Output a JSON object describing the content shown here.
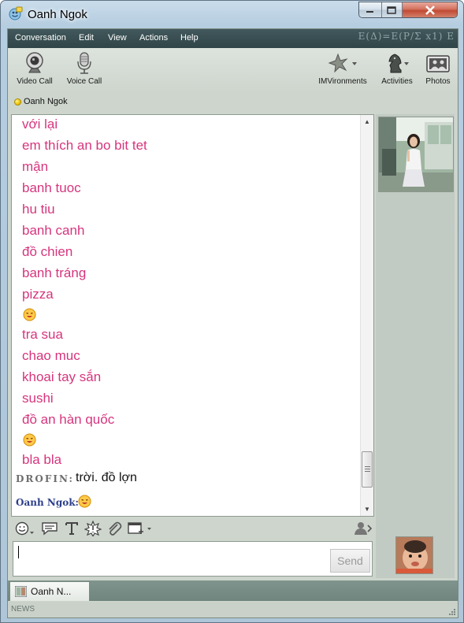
{
  "window": {
    "title": "Oanh Ngok"
  },
  "menu": {
    "items": [
      "Conversation",
      "Edit",
      "View",
      "Actions",
      "Help"
    ],
    "decoration": "E(Δ)=E(P/Σ x1) E"
  },
  "toolbar": {
    "video_call": "Video Call",
    "voice_call": "Voice Call",
    "imvironments": "IMVironments",
    "activities": "Activities",
    "photos": "Photos"
  },
  "contact": {
    "name": "Oanh Ngok",
    "status_color": "#f0c000"
  },
  "conversation": {
    "lines": [
      {
        "type": "text",
        "text": "với lại"
      },
      {
        "type": "text",
        "text": "em thích an bo bit tet"
      },
      {
        "type": "text",
        "text": "mận"
      },
      {
        "type": "text",
        "text": "banh tuoc"
      },
      {
        "type": "text",
        "text": "hu tiu"
      },
      {
        "type": "text",
        "text": "banh canh"
      },
      {
        "type": "text",
        "text": "đồ chien"
      },
      {
        "type": "text",
        "text": "banh tráng"
      },
      {
        "type": "text",
        "text": "pizza"
      },
      {
        "type": "emoticon",
        "icon": "smiley-emoticon"
      },
      {
        "type": "text",
        "text": "tra sua"
      },
      {
        "type": "text",
        "text": "chao muc"
      },
      {
        "type": "text",
        "text": "khoai tay sắn"
      },
      {
        "type": "text",
        "text": "sushi"
      },
      {
        "type": "text",
        "text": "đồ an hàn quốc"
      },
      {
        "type": "emoticon",
        "icon": "smiley-emoticon"
      },
      {
        "type": "text",
        "text": "bla bla"
      }
    ],
    "drofin": {
      "sender": "DROFIN:",
      "text": "trời. đồ lợn"
    },
    "oanh": {
      "sender": "Oanh Ngok:",
      "icon": "smiley-emoticon"
    },
    "message_color": "#d6357d"
  },
  "format_toolbar": [
    "emoticon-icon",
    "audible-icon",
    "text-format-icon",
    "buzz-icon",
    "attach-icon",
    "window-icon",
    "contact-icon"
  ],
  "input": {
    "value": "",
    "send_label": "Send"
  },
  "tab": {
    "label": "Oanh N..."
  },
  "news": {
    "label": "NEWS"
  }
}
